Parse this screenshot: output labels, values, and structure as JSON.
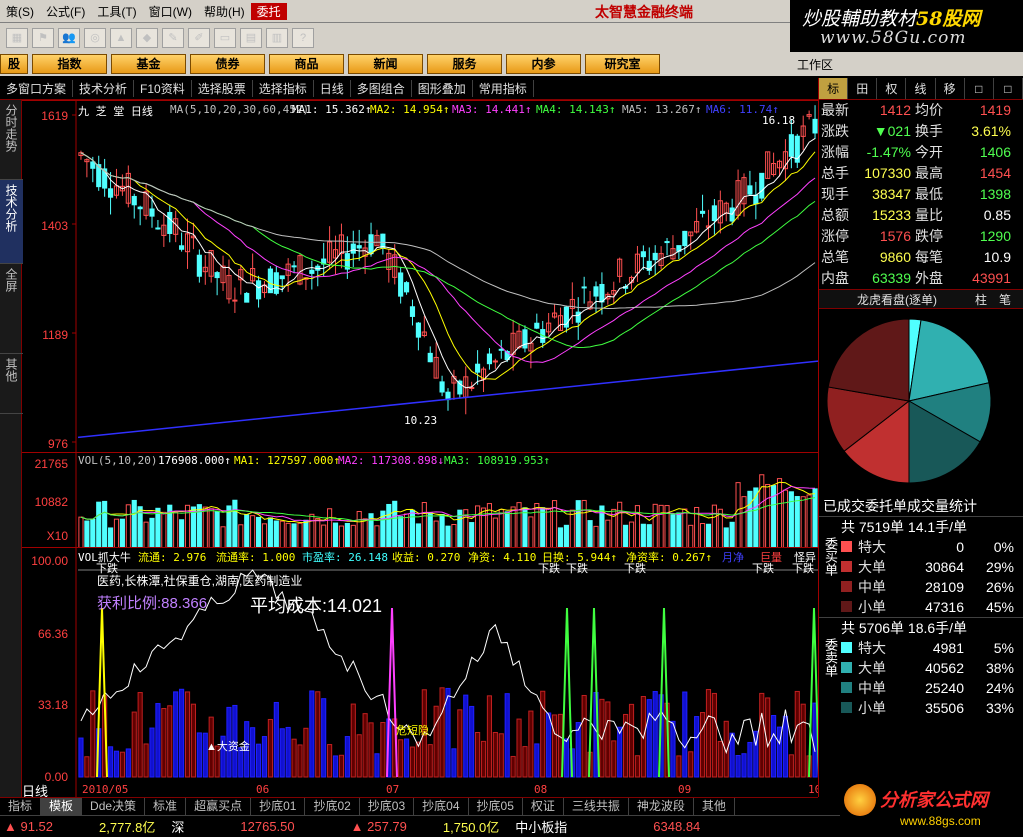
{
  "menu": [
    "策(S)",
    "公式(F)",
    "工具(T)",
    "窗口(W)",
    "帮助(H)",
    "委托"
  ],
  "brand": "太智慧金融终端",
  "banner": {
    "line1a": "炒股輔助教材",
    "line1b": "58股网",
    "line2": "www.58Gu.com"
  },
  "nav": [
    "股",
    "指数",
    "基金",
    "债券",
    "商品",
    "新闻",
    "服务",
    "内参",
    "研究室"
  ],
  "workzone": "工作区",
  "subbar": [
    "多窗口方案",
    "技术分析",
    "F10资料",
    "选择股票",
    "选择指标",
    "日线",
    "多图组合",
    "图形叠加",
    "常用指标"
  ],
  "sidebar": [
    "分时走势",
    "技术分析",
    "全屏",
    "其他"
  ],
  "main": {
    "stock_title": "九 芝 堂 日线",
    "ma_line": "MA(5,10,20,30,60,452)",
    "ma1": "MA1: 15.362↑",
    "ma2": "MA2: 14.954↑",
    "ma3": "MA3: 14.441↑",
    "ma4": "MA4: 14.143↑",
    "ma5": "MA5: 13.267↑",
    "ma6": "MA6: 11.74↑",
    "y_labels": [
      "1619",
      "1403",
      "1189",
      "976"
    ],
    "high_mark": "16.18",
    "low_mark": "10.23"
  },
  "vol": {
    "title": "VOL(5,10,20)",
    "v": "176908.000↑",
    "ma1": "MA1: 127597.000↑",
    "ma2": "MA2: 117308.898↓",
    "ma3": "MA3: 108919.953↑",
    "y_labels": [
      "21765",
      "10882",
      "X10"
    ]
  },
  "ind": {
    "title": "VOL抓大牛",
    "liutong": "流通: 2.976",
    "liutonglv": "流通率: 1.000",
    "shiying": "市盈率: 26.148",
    "shouyi": "收益: 0.270",
    "jingzi": "净资: 4.110",
    "rihuan": "日换: 5.944↑",
    "jingzilv": "净资率: 0.267↑",
    "yuejing": "月净",
    "juliang": "巨量",
    "guaiyi": "怪异",
    "industry": "医药,长株潭,社保重仓,湖南,医药制造业",
    "profit_ratio": "获利比例:88.366",
    "avg_cost": "平均成本:14.021",
    "y_labels": [
      "100.00",
      "66.36",
      "33.18",
      "0.00"
    ],
    "xiadie_labels": [
      "下跌",
      "下跌",
      "下跌",
      "下跌",
      "下跌",
      "下跌"
    ],
    "big_fund": "▲大资金",
    "danger": "危短隐"
  },
  "timeline": [
    "2010/05",
    "06",
    "07",
    "08",
    "09",
    "10"
  ],
  "period": "日线",
  "right": {
    "tabs": [
      "标",
      "田",
      "权",
      "线",
      "移",
      "□",
      "□"
    ],
    "quotes": [
      {
        "k": "最新",
        "v": "1412",
        "vc": "red",
        "k2": "均价",
        "v2": "1419",
        "v2c": "red"
      },
      {
        "k": "涨跌",
        "v": "▼021",
        "vc": "grn",
        "k2": "换手",
        "v2": "3.61%",
        "v2c": "yel"
      },
      {
        "k": "涨幅",
        "v": "-1.47%",
        "vc": "grn",
        "k2": "今开",
        "v2": "1406",
        "v2c": "grn"
      },
      {
        "k": "总手",
        "v": "107330",
        "vc": "yel",
        "k2": "最高",
        "v2": "1454",
        "v2c": "red"
      },
      {
        "k": "现手",
        "v": "38347",
        "vc": "yel",
        "k2": "最低",
        "v2": "1398",
        "v2c": "grn"
      },
      {
        "k": "总额",
        "v": "15233",
        "vc": "yel",
        "k2": "量比",
        "v2": "0.85",
        "v2c": "wht"
      },
      {
        "k": "涨停",
        "v": "1576",
        "vc": "red",
        "k2": "跌停",
        "v2": "1290",
        "v2c": "grn"
      },
      {
        "k": "总笔",
        "v": "9860",
        "vc": "yel",
        "k2": "每笔",
        "v2": "10.9",
        "v2c": "wht"
      },
      {
        "k": "内盘",
        "v": "63339",
        "vc": "grn",
        "k2": "外盘",
        "v2": "43991",
        "v2c": "red"
      }
    ],
    "pie_title": "龙虎看盘(逐单)",
    "pie_tabs": [
      "柱",
      "笔"
    ],
    "pie_caption": "已成交委托单成交量统计",
    "buy": {
      "head": "共 7519单 14.1手/单",
      "side": "委买单",
      "rows": [
        {
          "n": "特大",
          "v": "0",
          "p": "0%",
          "c": "#ff5050"
        },
        {
          "n": "大单",
          "v": "30864",
          "p": "29%",
          "c": "#c03030"
        },
        {
          "n": "中单",
          "v": "28109",
          "p": "26%",
          "c": "#902020"
        },
        {
          "n": "小单",
          "v": "47316",
          "p": "45%",
          "c": "#601818"
        }
      ]
    },
    "sell": {
      "head": "共 5706单 18.6手/单",
      "side": "委卖单",
      "rows": [
        {
          "n": "特大",
          "v": "4981",
          "p": "5%",
          "c": "#50ffff"
        },
        {
          "n": "大单",
          "v": "40562",
          "p": "38%",
          "c": "#30b0b0"
        },
        {
          "n": "中单",
          "v": "25240",
          "p": "24%",
          "c": "#208080"
        },
        {
          "n": "小单",
          "v": "35506",
          "p": "33%",
          "c": "#185858"
        }
      ]
    }
  },
  "bottom_tabs": [
    "指标",
    "模板",
    "Dde决策",
    "标准",
    "超赢买点",
    "抄底01",
    "抄底02",
    "抄底03",
    "抄底04",
    "抄底05",
    "权证",
    "三线共振",
    "神龙波段",
    "其他"
  ],
  "status": {
    "s1": "▲ 91.52",
    "s2": "2,777.8亿",
    "s3": "深",
    "s4": "12765.50",
    "s5": "▲ 257.79",
    "s6": "1,750.0亿",
    "s7": "中小板指",
    "s8": "6348.84"
  },
  "footer_logo": {
    "title": "分析家公式网",
    "url": "www.88gs.com"
  },
  "colors": {
    "up": "#ff5050",
    "down": "#50ffff",
    "ma1": "#ffffff",
    "ma2": "#ffff00",
    "ma3": "#ff40ff",
    "ma4": "#40ff40",
    "ma5": "#c0c0c0",
    "ma6": "#4040ff"
  }
}
